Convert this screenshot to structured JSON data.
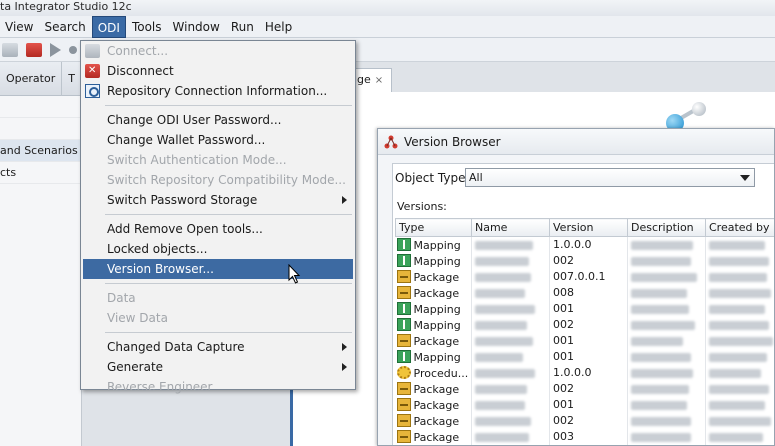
{
  "window": {
    "title": "ta Integrator Studio 12c"
  },
  "menubar": [
    "View",
    "Search",
    "ODI",
    "Tools",
    "Window",
    "Run",
    "Help"
  ],
  "left_panel": {
    "tabs": [
      "Operator",
      "T"
    ],
    "rows": [
      "",
      "",
      "and Scenarios",
      "cts",
      "",
      ""
    ]
  },
  "doc_tab": {
    "label": "ge",
    "close": "×"
  },
  "odi_menu": {
    "items": [
      {
        "label": "Connect...",
        "disabled": true,
        "icon": "connect-icon"
      },
      {
        "label": "Disconnect",
        "disabled": false,
        "icon": "disconnect-icon"
      },
      {
        "label": "Repository Connection Information...",
        "disabled": false,
        "icon": "info-icon"
      },
      {
        "label": "Change ODI User Password...",
        "disabled": false
      },
      {
        "label": "Change Wallet Password...",
        "disabled": false
      },
      {
        "label": "Switch Authentication Mode...",
        "disabled": true
      },
      {
        "label": "Switch Repository Compatibility Mode...",
        "disabled": true
      },
      {
        "label": "Switch Password Storage",
        "disabled": false,
        "submenu": true
      },
      {
        "label": "Add Remove Open tools...",
        "disabled": false
      },
      {
        "label": "Locked objects...",
        "disabled": false
      },
      {
        "label": "Version Browser...",
        "disabled": false,
        "hover": true
      },
      {
        "label": "Data",
        "disabled": true
      },
      {
        "label": "View Data",
        "disabled": true
      },
      {
        "label": "Changed Data Capture",
        "disabled": false,
        "submenu": true
      },
      {
        "label": "Generate",
        "disabled": false,
        "submenu": true
      },
      {
        "label": "Reverse Engineer",
        "disabled": true
      }
    ]
  },
  "version_browser": {
    "title": "Version Browser",
    "object_type_label": "Object Type:",
    "object_type_value": "All",
    "versions_label": "Versions:",
    "columns": [
      "Type",
      "Name",
      "Version",
      "Description",
      "Created by"
    ],
    "rows": [
      {
        "type": "Mapping",
        "version": "1.0.0.0"
      },
      {
        "type": "Mapping",
        "version": "002"
      },
      {
        "type": "Package",
        "version": "007.0.0.1"
      },
      {
        "type": "Package",
        "version": "008"
      },
      {
        "type": "Mapping",
        "version": "001"
      },
      {
        "type": "Mapping",
        "version": "002"
      },
      {
        "type": "Package",
        "version": "001"
      },
      {
        "type": "Mapping",
        "version": "001"
      },
      {
        "type": "Procedu...",
        "version": "1.0.0.0"
      },
      {
        "type": "Package",
        "version": "002"
      },
      {
        "type": "Package",
        "version": "001"
      },
      {
        "type": "Package",
        "version": "002"
      },
      {
        "type": "Package",
        "version": "003"
      }
    ]
  },
  "colors": {
    "accent": "#3a6aa5",
    "menu_hover": "#3d6aa2",
    "disabled_text": "#a2a6ab"
  }
}
